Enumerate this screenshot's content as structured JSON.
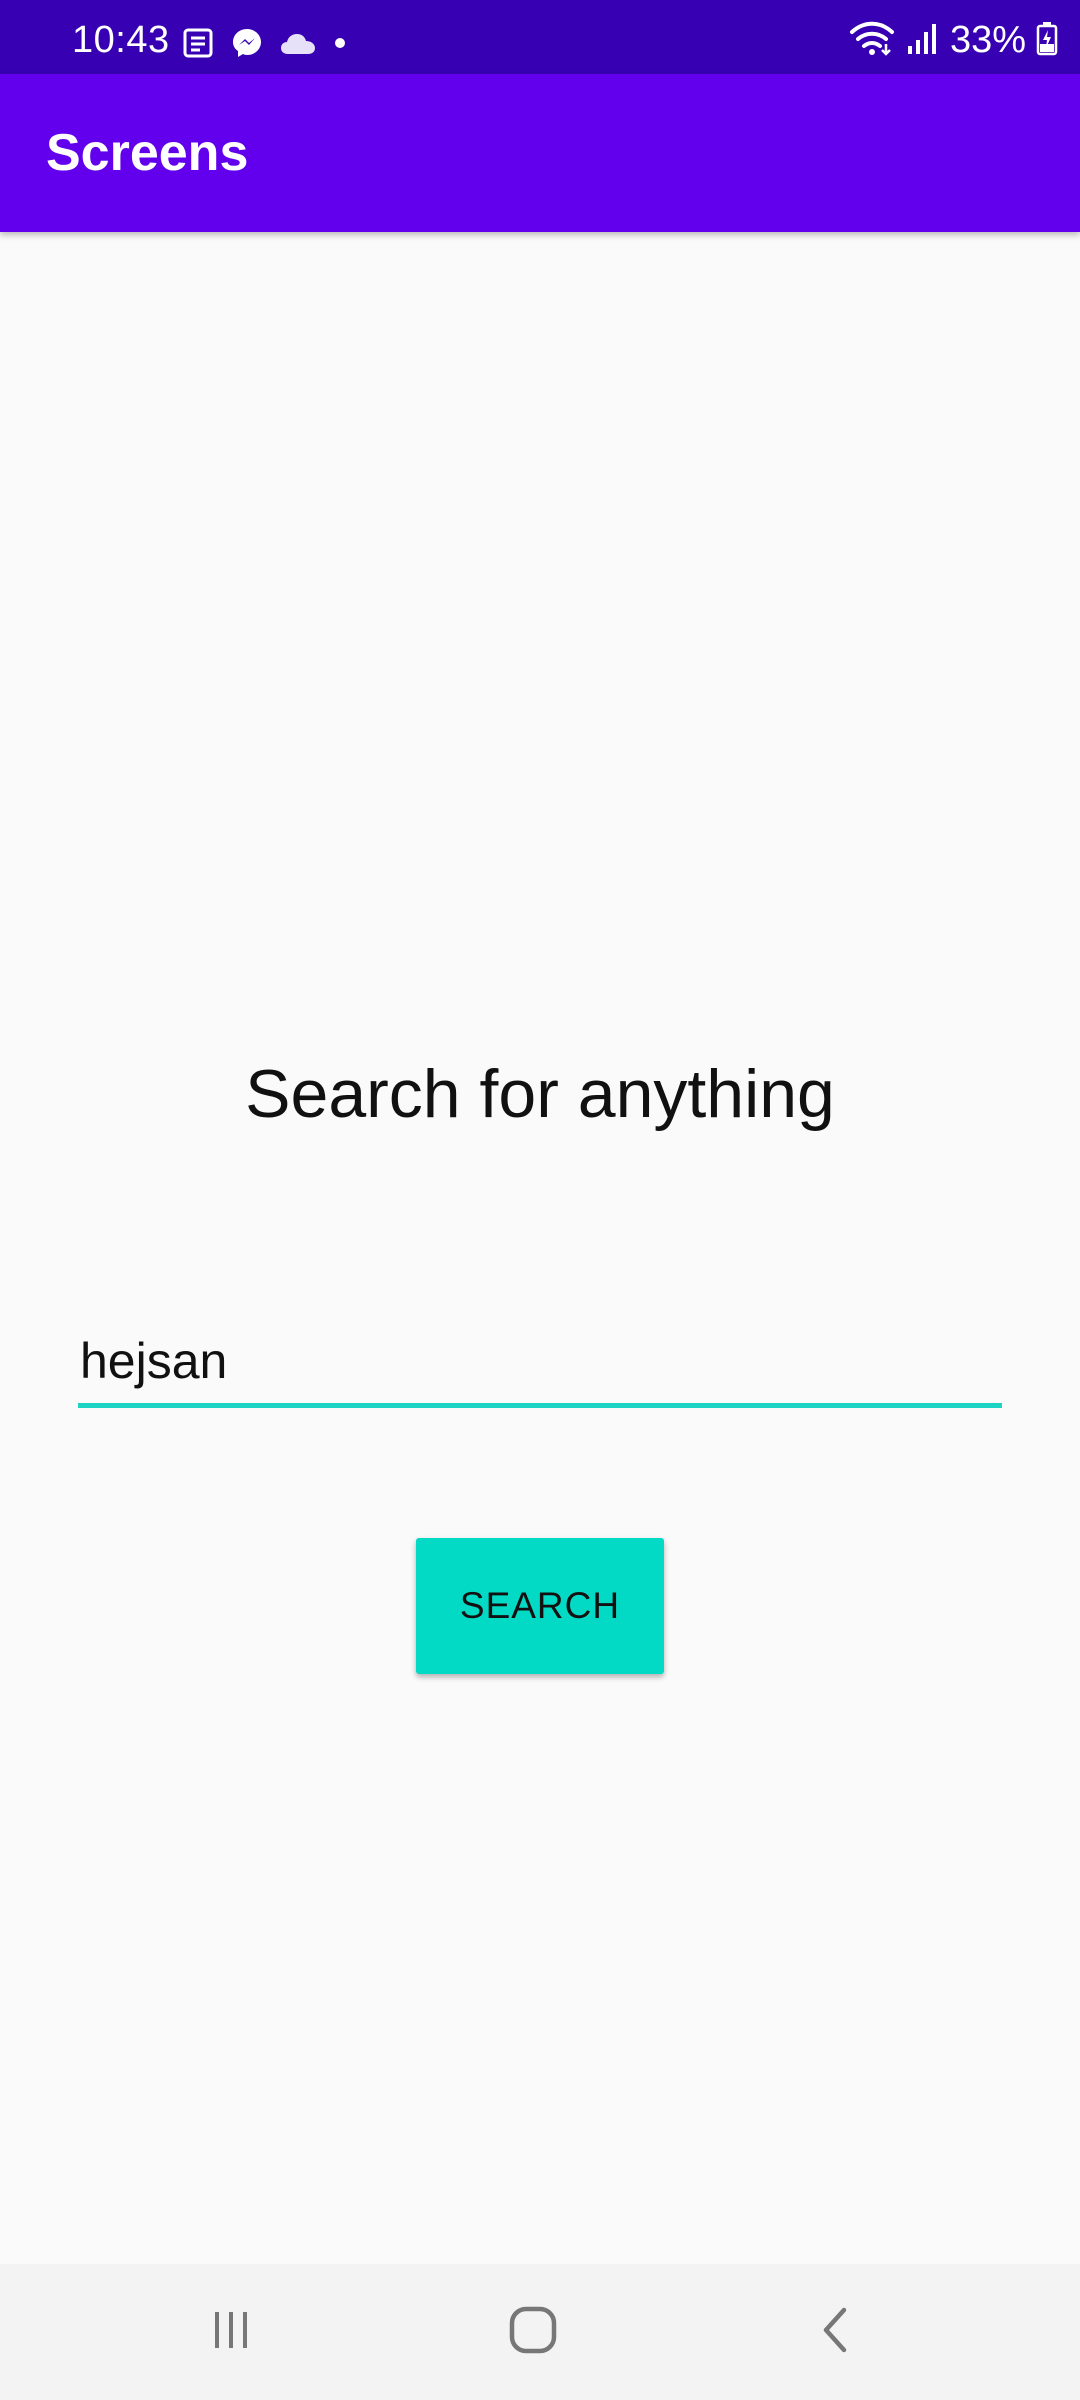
{
  "status_bar": {
    "time": "10:43",
    "battery": "33%",
    "icons": [
      "news-icon",
      "messenger-icon",
      "cloud-icon",
      "dot-icon",
      "wifi-icon",
      "signal-icon",
      "battery-icon"
    ]
  },
  "app_bar": {
    "title": "Screens",
    "color": "#6200ee"
  },
  "main": {
    "heading": "Search for anything",
    "search_value": "hejsan",
    "search_button_label": "SEARCH",
    "accent_color": "#03dac5"
  },
  "nav_bar": {
    "buttons": [
      "recents-icon",
      "home-icon",
      "back-icon"
    ]
  }
}
